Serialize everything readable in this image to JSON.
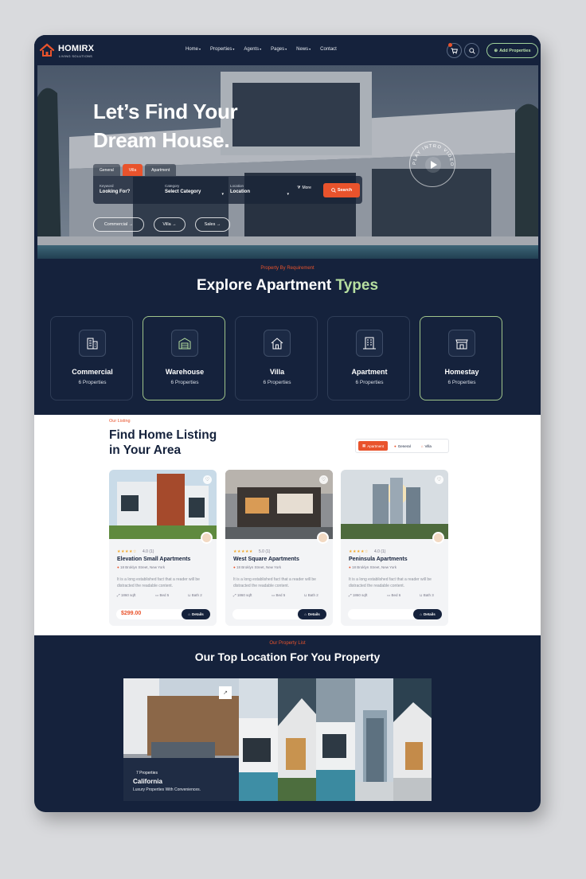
{
  "nav": {
    "brand": "HOMIRX",
    "brand_sub": "LIVING SOLUTIONS",
    "menu": [
      {
        "label": "Home",
        "caret": "▾"
      },
      {
        "label": "Properties",
        "caret": "▾"
      },
      {
        "label": "Agents",
        "caret": "▾"
      },
      {
        "label": "Pages",
        "caret": "▾"
      },
      {
        "label": "News",
        "caret": "▾"
      },
      {
        "label": "Contact",
        "caret": ""
      }
    ],
    "add_button": "Add Properties",
    "add_icon": "⊕"
  },
  "hero": {
    "title_line1": "Let’s Find Your",
    "title_line2": "Dream House.",
    "tabs": [
      "General",
      "Villa",
      "Apartment"
    ],
    "active_tab": "Villa",
    "fields": [
      {
        "label": "Keyword",
        "value": "Looking For?"
      },
      {
        "label": "Category",
        "value": "Select Category"
      },
      {
        "label": "Location",
        "value": "Location"
      }
    ],
    "more": "More",
    "search_button": "Search",
    "pills": [
      "Commercial",
      "Villa",
      "Sales"
    ],
    "arrow": "→",
    "play_text": "PLAY INTRO VIDEO"
  },
  "explore": {
    "kicker": "Property By Requirement",
    "title_main": "Explore Apartment",
    "title_accent": "Types",
    "types": [
      {
        "name": "Commercial",
        "count": "6 Properties",
        "icon": "building-icon"
      },
      {
        "name": "Warehouse",
        "count": "6 Properties",
        "icon": "warehouse-icon"
      },
      {
        "name": "Villa",
        "count": "6 Properties",
        "icon": "house-icon"
      },
      {
        "name": "Apartment",
        "count": "6 Properties",
        "icon": "apartment-icon"
      },
      {
        "name": "Homestay",
        "count": "6 Properties",
        "icon": "shop-icon"
      }
    ]
  },
  "listing": {
    "kicker": "Our Listing",
    "title_line1": "Find Home Listing",
    "title_line2": "in Your Area",
    "filter_tabs": [
      "Apartment",
      "General",
      "Villa"
    ],
    "cards": [
      {
        "stars": "★★★★☆",
        "rating": "4.0 (1)",
        "title": "Elevation Small Apartments",
        "address": "18 Broklyn Street, New York",
        "desc": "It is a long established fact that a reader will be distracted the readable content.",
        "sqft": "1860 sqft",
        "bed": "Bed 5",
        "bath": "Bath 2",
        "price": "$299.00",
        "details": "Details"
      },
      {
        "stars": "★★★★★",
        "rating": "5.0 (1)",
        "title": "West Square Apartments",
        "address": "18 Broklyn Street, New York",
        "desc": "It is a long established fact that a reader will be distracted the readable content.",
        "sqft": "1860 sqft",
        "bed": "Bed 5",
        "bath": "Bath 2",
        "price": "",
        "details": "Details"
      },
      {
        "stars": "★★★★☆",
        "rating": "4.0 (1)",
        "title": "Peninsula Apartments",
        "address": "18 Broklyn Street, New York",
        "desc": "It is a long established fact that a reader will be distracted the readable content.",
        "sqft": "1860 sqft",
        "bed": "Bed 6",
        "bath": "Bath 3",
        "price": "",
        "details": "Details"
      }
    ]
  },
  "locations": {
    "kicker": "Our Property List",
    "title": "Our Top Location For You Property",
    "featured": {
      "count": "7 Properties",
      "name": "California",
      "tagline": "Luxury Properties With Conveniences."
    }
  },
  "colors": {
    "navy": "#15223c",
    "accent": "#e9532c",
    "green": "#b6dfa0"
  }
}
